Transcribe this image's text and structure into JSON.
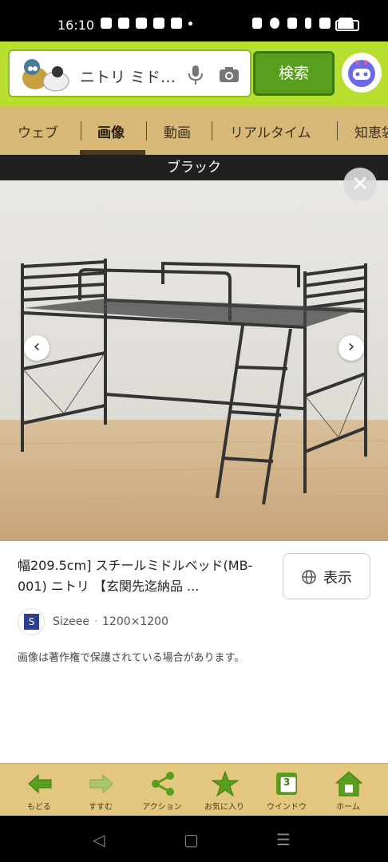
{
  "status_bar": {
    "time": "16:10"
  },
  "search": {
    "query": "ニトリ ミド…",
    "button_label": "検索"
  },
  "tabs": [
    {
      "label": "ウェブ"
    },
    {
      "label": "画像"
    },
    {
      "label": "動画"
    },
    {
      "label": "リアルタイム"
    },
    {
      "label": "知恵袋"
    }
  ],
  "image_viewer": {
    "caption": "ブラック",
    "close_label": "✕"
  },
  "result": {
    "title": "幅209.5cm] スチールミドルベッド(MB-001) ニトリ 【玄関先迄納品 ...",
    "view_button_label": "表示",
    "source_name": "Sizeee",
    "source_separator": "·",
    "dimensions": "1200×1200",
    "copyright_note": "画像は著作権で保護されている場合があります。"
  },
  "toolbar": {
    "items": [
      {
        "label": "もどる"
      },
      {
        "label": "すすむ"
      },
      {
        "label": "アクション"
      },
      {
        "label": "お気に入り"
      },
      {
        "label": "ウインドウ"
      },
      {
        "label": "ホーム"
      }
    ],
    "window_count": "3"
  },
  "colors": {
    "brand_green": "#b8df2f",
    "search_button": "#5a9e1d",
    "tab_bg": "#d8b876",
    "toolbar_bg": "#e3c77e"
  }
}
